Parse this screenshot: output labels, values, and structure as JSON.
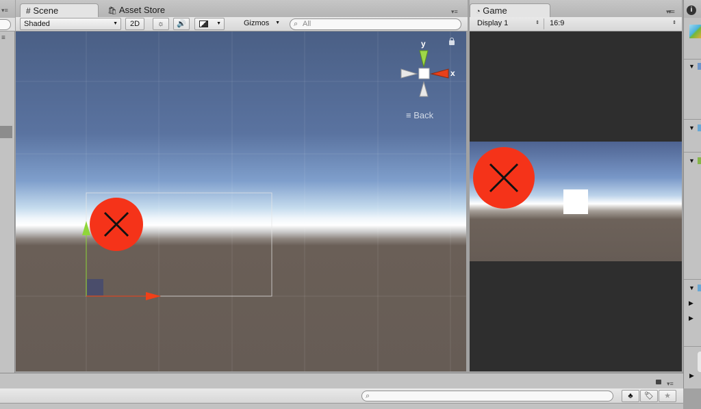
{
  "window": {
    "tabs": {
      "scene": "Scene",
      "asset_store": "Asset Store",
      "game": "Game"
    }
  },
  "scene_toolbar": {
    "shading_mode": "Shaded",
    "mode_2d": "2D",
    "gizmos": "Gizmos",
    "search_placeholder": "All"
  },
  "scene_view": {
    "gizmo_axis_y": "y",
    "gizmo_axis_x": "x",
    "view_label": "Back"
  },
  "game_toolbar": {
    "display": "Display 1",
    "aspect": "16:9"
  },
  "colors": {
    "marker_red": "#f53319",
    "axis_green": "#8fd63a",
    "axis_red": "#f04018",
    "sky_top": "#4a5f85",
    "ground": "#675c54"
  }
}
